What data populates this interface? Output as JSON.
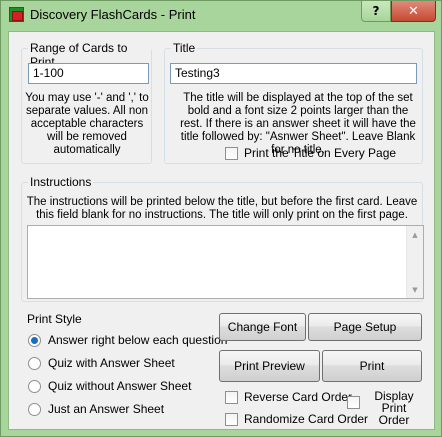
{
  "window": {
    "title": "Discovery FlashCards - Print",
    "help_label": "?",
    "close_label": "✕"
  },
  "range": {
    "group_label": "Range of Cards to Print",
    "value": "1-100",
    "note": "You may use '-' and ',' to separate values. All non acceptable characters will be removed automatically"
  },
  "title_section": {
    "group_label": "Title",
    "value": "Testing3",
    "note": "The title will be displayed at the top of the set bold and a font size 2 points larger than the rest. If there is an answer sheet it will have the title followed by: \"Asnwer Sheet\". Leave Blank for no title.",
    "every_page_label": "Print the Title on Every Page"
  },
  "instructions": {
    "group_label": "Instructions",
    "note": "The instructions will be printed below the title, but before the first card. Leave this field blank for no instructions. The title will only print on the first page.",
    "value": ""
  },
  "print_style": {
    "group_label": "Print Style",
    "options": [
      {
        "label": "Answer right below each question",
        "checked": true
      },
      {
        "label": "Quiz with Answer Sheet",
        "checked": false
      },
      {
        "label": "Quiz without Answer Sheet",
        "checked": false
      },
      {
        "label": "Just an Answer Sheet",
        "checked": false
      }
    ]
  },
  "buttons": {
    "change_font": "Change Font",
    "page_setup": "Page Setup",
    "print_preview": "Print Preview",
    "print": "Print"
  },
  "options": {
    "reverse_order": "Reverse Card Order",
    "randomize_order": "Randomize Card Order",
    "display_print_order": "Display Print Order"
  }
}
